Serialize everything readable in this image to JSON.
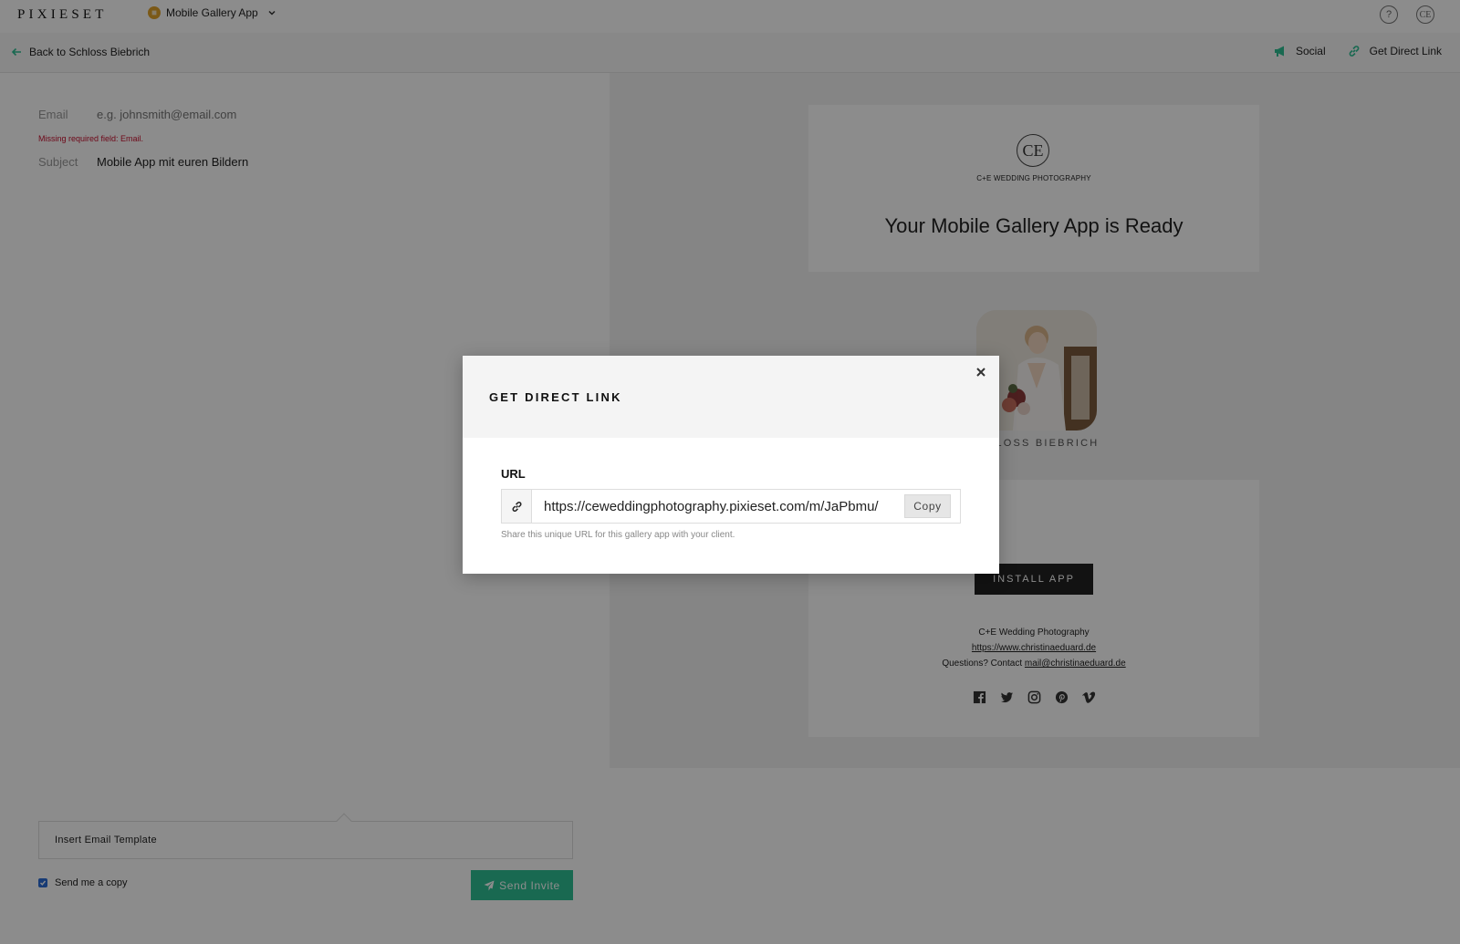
{
  "topbar": {
    "logo": "PIXIESET",
    "app_name": "Mobile Gallery App",
    "help_icon": "help-circle-icon",
    "avatar_initials": "CE"
  },
  "subbar": {
    "back_label": "Back to Schloss Biebrich",
    "social_label": "Social",
    "direct_link_label": "Get Direct Link",
    "accent_color": "#2fbf94"
  },
  "form": {
    "email_label": "Email",
    "email_placeholder": "e.g. johnsmith@email.com",
    "email_value": "",
    "error_text": "Missing required field: Email.",
    "subject_label": "Subject",
    "subject_value": "Mobile App mit euren Bildern",
    "template_label": "Insert Email Template",
    "send_copy_label": "Send me a copy",
    "send_copy_checked": true,
    "send_button_label": "Send Invite"
  },
  "preview": {
    "brand_monogram": "CE",
    "brand_name": "C+E WEDDING PHOTOGRAPHY",
    "headline": "Your Mobile Gallery App is Ready",
    "gallery_name": "SCHLOSS BIEBRICH",
    "install_label": "INSTALL APP",
    "company": "C+E Wedding Photography",
    "website": "https://www.christinaeduard.de",
    "questions_prefix": "Questions? Contact ",
    "contact_email": "mail@christinaeduard.de",
    "social_icons": [
      "facebook-icon",
      "twitter-icon",
      "instagram-icon",
      "pinterest-icon",
      "vimeo-icon"
    ]
  },
  "modal": {
    "title": "GET DIRECT LINK",
    "url_label": "URL",
    "url_value": "https://ceweddingphotography.pixieset.com/m/JaPbmu/",
    "copy_label": "Copy",
    "help_text": "Share this unique URL for this gallery app with your client."
  }
}
